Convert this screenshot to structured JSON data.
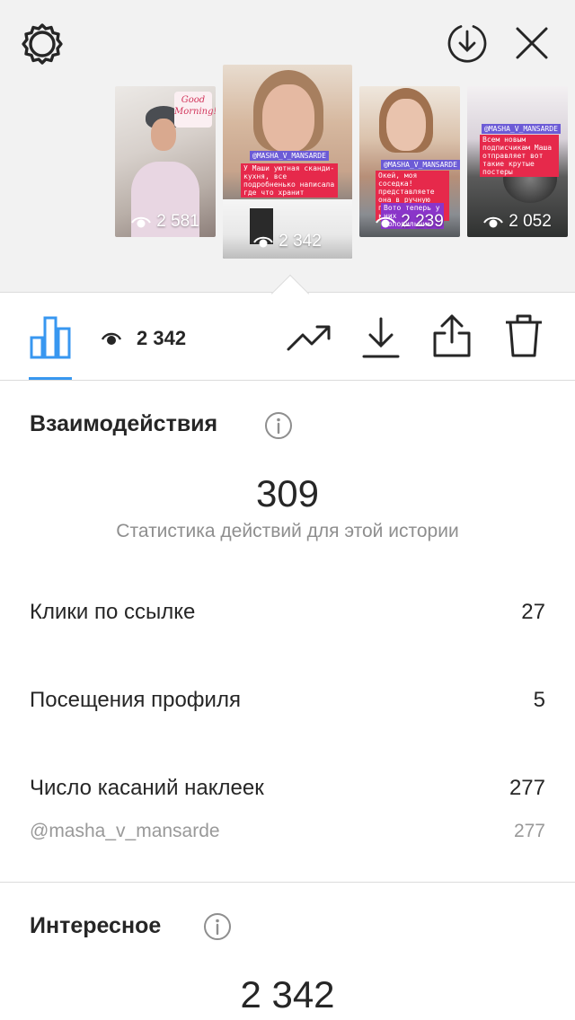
{
  "stories": [
    {
      "views": "2 581",
      "sign_text": "Good Morning!"
    },
    {
      "views": "2 342",
      "mention": "@MASHA_V_MANSARDE",
      "caption": "У Маши уютная сканди-кухня, все подробненько написала где что хранит"
    },
    {
      "views": "2 239",
      "mention": "@MASHA_V_MANSARDE",
      "caption": "Окей, моя соседка! представляете она в ручную покрасила свою квартиру",
      "caption2": "Вото теперь у них холодильник"
    },
    {
      "views": "2 052",
      "mention": "@MASHA_V_MANSARDE",
      "caption": "Всем новым подписчикам Маша отправляет вот такие крутые постеры"
    }
  ],
  "toolbar": {
    "views_count": "2 342"
  },
  "interactions": {
    "title": "Взаимодействия",
    "total": "309",
    "subtitle": "Статистика действий для этой истории",
    "rows": [
      {
        "label": "Клики по ссылке",
        "value": "27"
      },
      {
        "label": "Посещения профиля",
        "value": "5"
      },
      {
        "label": "Число касаний наклеек",
        "value": "277"
      }
    ],
    "sticker_sub": {
      "label": "@masha_v_mansarde",
      "value": "277"
    }
  },
  "discovery": {
    "title": "Интересное",
    "total": "2 342"
  },
  "colors": {
    "accent": "#3897f0",
    "text": "#262626",
    "muted": "#8e8e8e",
    "divider": "#dbdbdb",
    "strip_bg": "#f2f2f2"
  },
  "icons": [
    "settings-gear-icon",
    "download-circle-icon",
    "close-icon",
    "bar-chart-icon",
    "eye-icon",
    "trending-up-icon",
    "download-icon",
    "share-icon",
    "trash-icon",
    "info-icon"
  ]
}
